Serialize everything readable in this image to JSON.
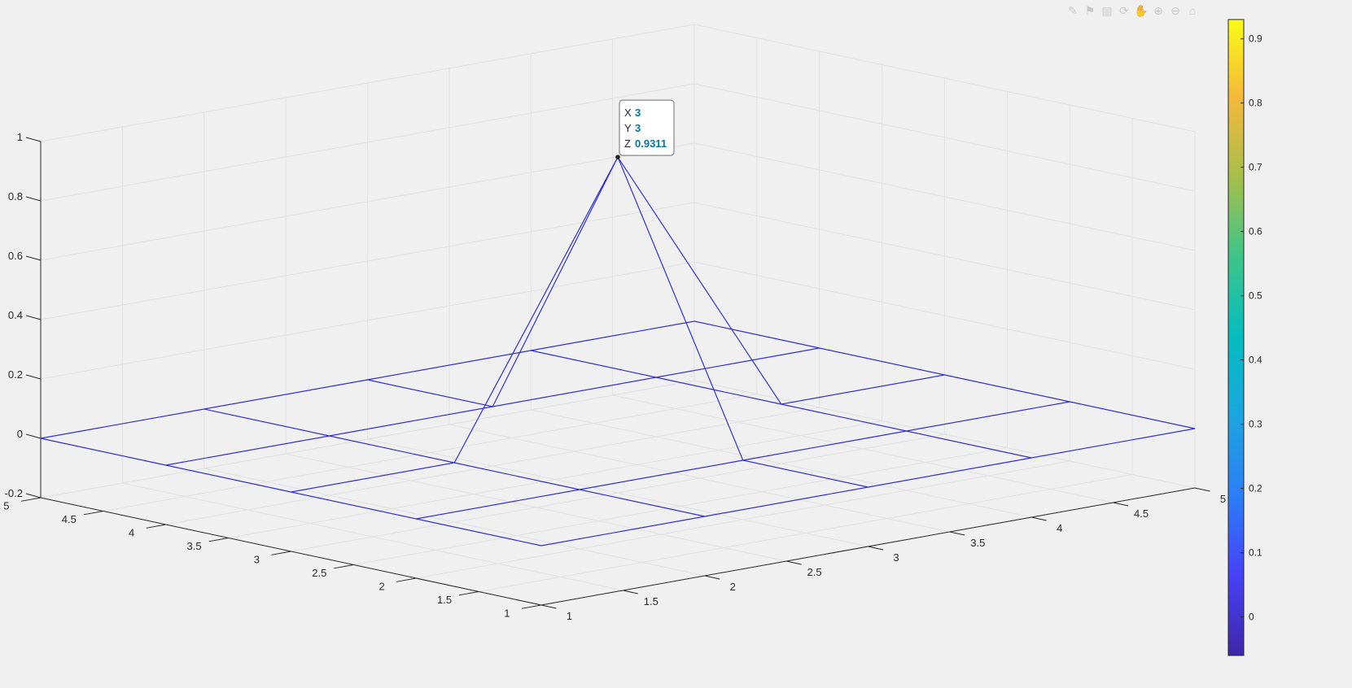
{
  "toolbar": {
    "icons": [
      "brush-icon",
      "data-tips-icon",
      "export-icon",
      "rotate-3d-icon",
      "pan-icon",
      "zoom-in-icon",
      "zoom-out-icon",
      "home-icon"
    ],
    "glyphs": [
      "✎",
      "⚑",
      "▤",
      "⟳",
      "✋",
      "⊕",
      "⊖",
      "⌂"
    ]
  },
  "datatip": {
    "x_label": "X",
    "x_value": "3",
    "y_label": "Y",
    "y_value": "3",
    "z_label": "Z",
    "z_value": "0.9311",
    "value_color": "#0076a8"
  },
  "colors": {
    "mesh": "#3030d8",
    "grid": "#e1e1e1",
    "axis": "#262626",
    "background": "#f0f0f0"
  },
  "chart_data": {
    "type": "mesh",
    "x": [
      1,
      2,
      3,
      4,
      5
    ],
    "y": [
      1,
      2,
      3,
      4,
      5
    ],
    "z": [
      [
        0,
        0,
        0,
        0,
        0
      ],
      [
        0,
        0,
        0,
        0,
        0
      ],
      [
        0,
        0,
        0.9311,
        0,
        0
      ],
      [
        0,
        0,
        0,
        0,
        0
      ],
      [
        0,
        0,
        0,
        0,
        0
      ]
    ],
    "xlim": [
      1,
      5
    ],
    "ylim": [
      1,
      5
    ],
    "zlim": [
      -0.2,
      1
    ],
    "x_ticks": [
      "1",
      "1.5",
      "2",
      "2.5",
      "3",
      "3.5",
      "4",
      "4.5",
      "5"
    ],
    "y_ticks": [
      "1",
      "1.5",
      "2",
      "2.5",
      "3",
      "3.5",
      "4",
      "4.5",
      "5"
    ],
    "z_ticks": [
      "-0.2",
      "0",
      "0.2",
      "0.4",
      "0.6",
      "0.8",
      "1"
    ],
    "grid": true,
    "colorbar": {
      "ticks": [
        "0",
        "0.1",
        "0.2",
        "0.3",
        "0.4",
        "0.5",
        "0.6",
        "0.7",
        "0.8",
        "0.9"
      ],
      "range": [
        -0.06,
        0.93
      ],
      "colormap": "parula"
    }
  }
}
